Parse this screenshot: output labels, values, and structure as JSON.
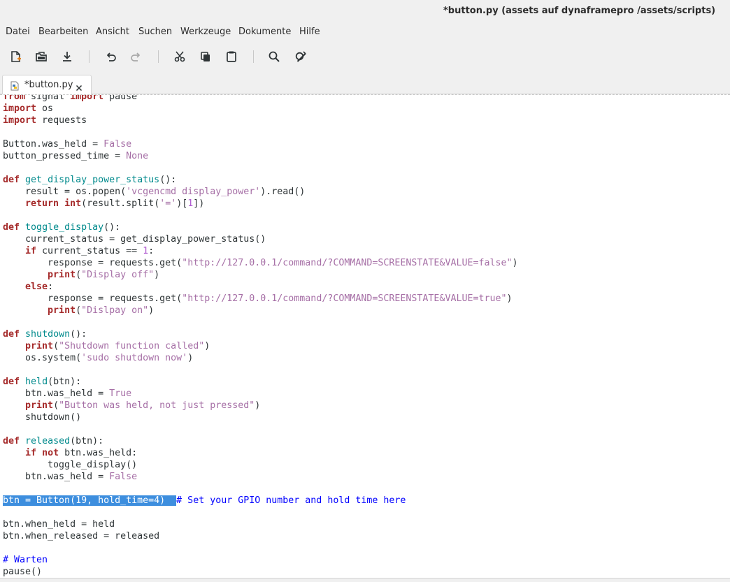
{
  "window": {
    "title": "*button.py (assets auf dynaframepro /assets/scripts)"
  },
  "menu": {
    "items": [
      "Datei",
      "Bearbeiten",
      "Ansicht",
      "Suchen",
      "Werkzeuge",
      "Dokumente",
      "Hilfe"
    ]
  },
  "toolbar": {
    "icons": [
      "new-document-icon",
      "open-document-icon",
      "save-icon",
      "undo-icon",
      "redo-icon",
      "cut-icon",
      "copy-icon",
      "paste-icon",
      "search-icon",
      "replace-icon"
    ]
  },
  "tabs": [
    {
      "label": "*button.py",
      "icon": "python-file-icon",
      "close_icon": "close-icon"
    }
  ],
  "editor": {
    "language": "python",
    "lines": [
      "from signal import pause",
      "import os",
      "import requests",
      "",
      "Button.was_held = False",
      "button_pressed_time = None",
      "",
      "def get_display_power_status():",
      "    result = os.popen('vcgencmd display_power').read()",
      "    return int(result.split('=')[1])",
      "",
      "def toggle_display():",
      "    current_status = get_display_power_status()",
      "    if current_status == 1:",
      "        response = requests.get(\"http://127.0.0.1/command/?COMMAND=SCREENSTATE&VALUE=false\")",
      "        print(\"Display off\")",
      "    else:",
      "        response = requests.get(\"http://127.0.0.1/command/?COMMAND=SCREENSTATE&VALUE=true\")",
      "        print(\"Dislpay on\")",
      "",
      "def shutdown():",
      "    print(\"Shutdown function called\")",
      "    os.system('sudo shutdown now')",
      "",
      "def held(btn):",
      "    btn.was_held = True",
      "    print(\"Button was held, not just pressed\")",
      "    shutdown()",
      "",
      "def released(btn):",
      "    if not btn.was_held:",
      "        toggle_display()",
      "    btn.was_held = False",
      "",
      "btn = Button(19, hold_time=4)  # Set your GPIO number and hold time here",
      "",
      "btn.when_held = held",
      "btn.when_released = released",
      "",
      "# Warten",
      "pause()"
    ],
    "selection": "btn = Button(19, hold_time=4)  "
  }
}
